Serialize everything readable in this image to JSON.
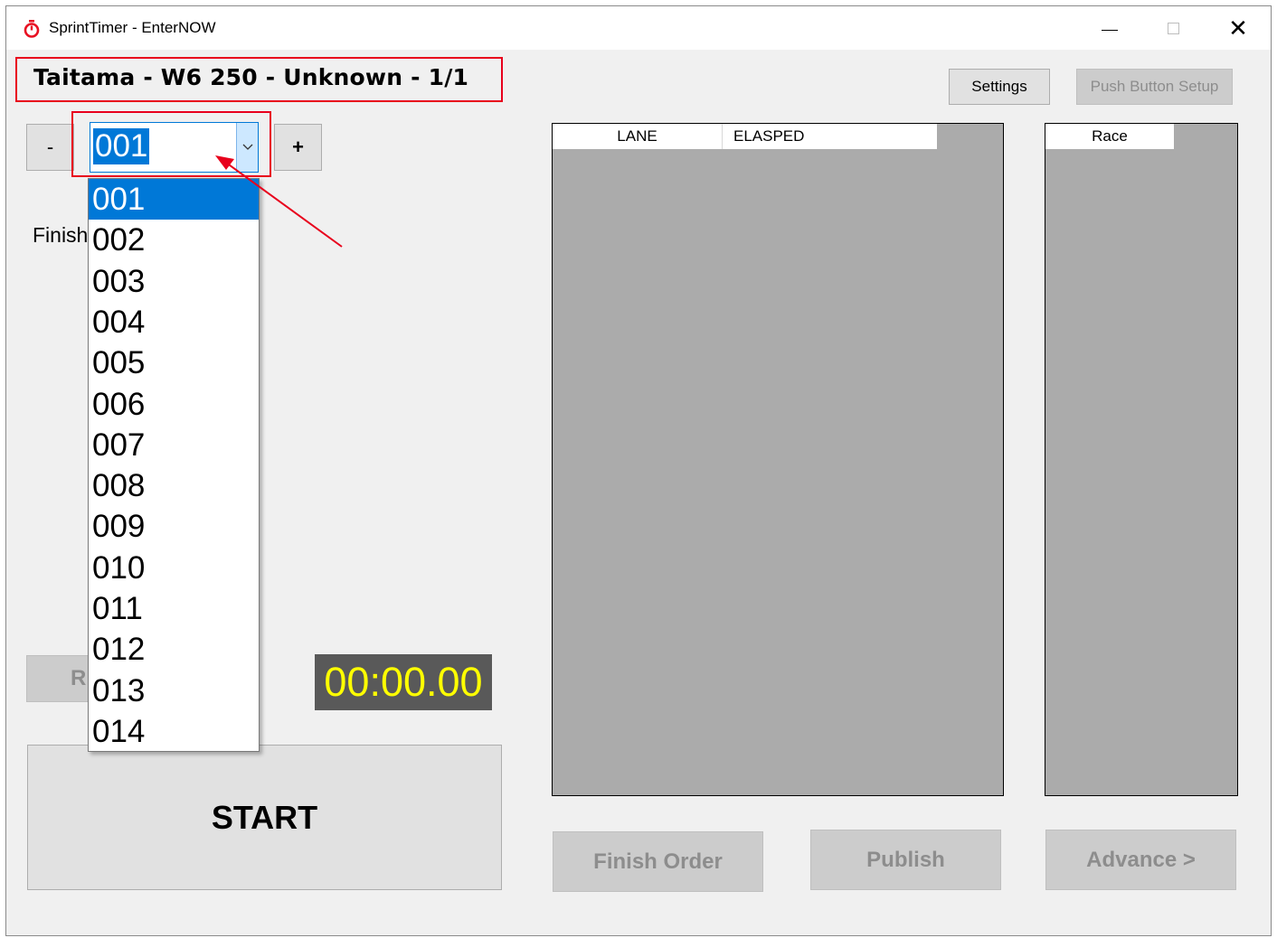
{
  "window": {
    "title": "SprintTimer - EnterNOW",
    "icon": "stopwatch-icon",
    "controls": {
      "minimize": "minimize-icon",
      "maximize": "maximize-icon",
      "close": "close-icon"
    }
  },
  "race": {
    "title": "Taitama - W6 250 - Unknown - 1/1"
  },
  "toolbar": {
    "settings_label": "Settings",
    "push_button_setup_label": "Push Button Setup"
  },
  "race_selector": {
    "decrement_label": "-",
    "increment_label": "+",
    "selected": "001",
    "options": [
      "001",
      "002",
      "003",
      "004",
      "005",
      "006",
      "007",
      "008",
      "009",
      "010",
      "011",
      "012",
      "013",
      "014"
    ]
  },
  "finish_label": "Finish",
  "reset_button_label": "R",
  "timer": {
    "display": "00:00.00"
  },
  "start_button_label": "START",
  "lane_grid": {
    "columns": [
      "LANE",
      "ELASPED"
    ]
  },
  "race_grid": {
    "columns": [
      "Race"
    ]
  },
  "actions": {
    "finish_order": "Finish Order",
    "publish": "Publish",
    "advance": "Advance >"
  },
  "colors": {
    "accent": "#0078d7",
    "highlight_box": "#e8001c",
    "timer_text": "#ffff00",
    "timer_bg": "#595959",
    "grid_bg": "#ababab"
  }
}
